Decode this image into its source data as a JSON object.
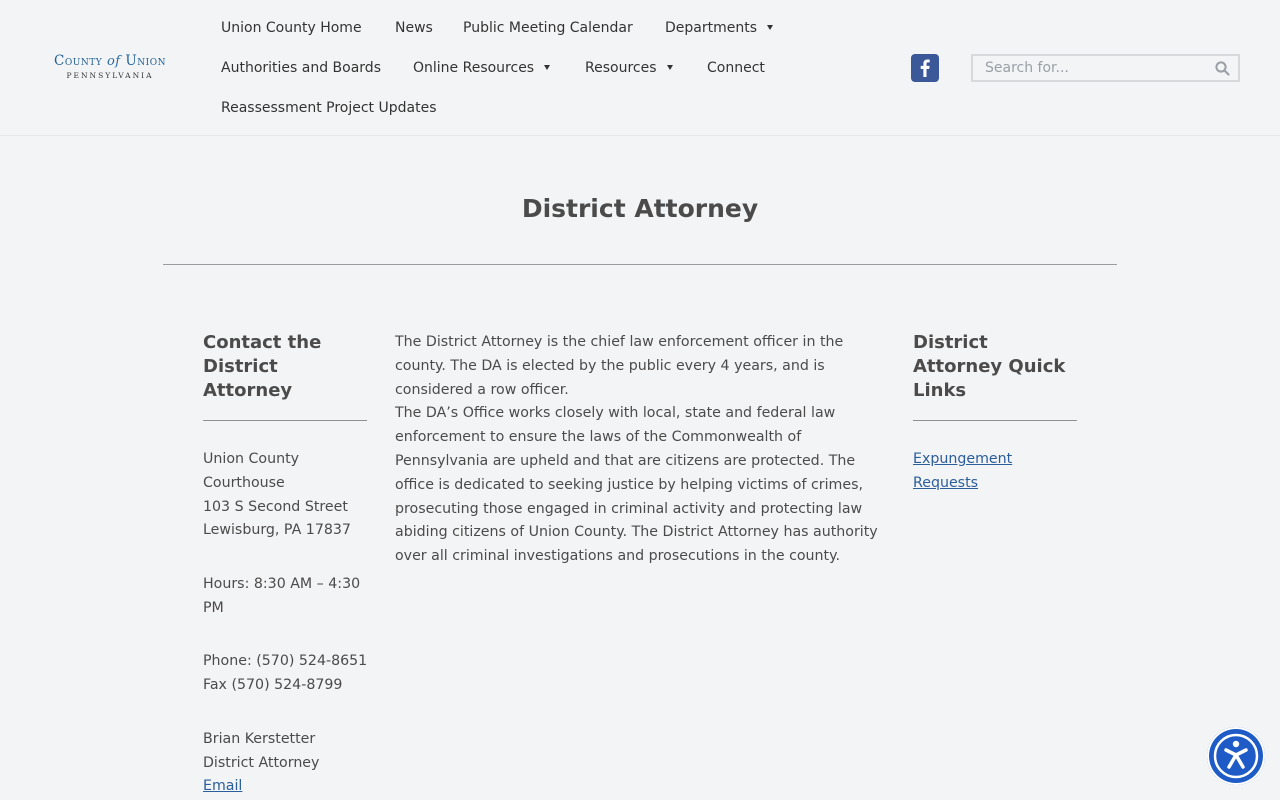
{
  "logo": {
    "line1_a": "County",
    "line1_of": "of",
    "line1_b": "Union",
    "line2": "PENNSYLVANIA"
  },
  "nav": {
    "items": [
      {
        "label": "Union County Home",
        "dropdown": false
      },
      {
        "label": "News",
        "dropdown": false
      },
      {
        "label": "Public Meeting Calendar",
        "dropdown": false
      },
      {
        "label": "Departments",
        "dropdown": true
      },
      {
        "label": "Authorities and Boards",
        "dropdown": false
      },
      {
        "label": "Online Resources",
        "dropdown": true
      },
      {
        "label": "Resources",
        "dropdown": true
      },
      {
        "label": "Connect",
        "dropdown": false
      },
      {
        "label": "Reassessment Project Updates",
        "dropdown": false
      }
    ]
  },
  "social": {
    "facebook_icon": "facebook-icon"
  },
  "search": {
    "placeholder": "Search for..."
  },
  "page": {
    "title": "District Attorney"
  },
  "contact": {
    "heading": "Contact the District Attorney",
    "address_1": "Union County Courthouse",
    "address_2": "103 S Second Street",
    "address_3": "Lewisburg, PA 17837",
    "hours": "Hours: 8:30 AM – 4:30 PM",
    "phone": "Phone: (570) 524-8651",
    "fax": "Fax (570) 524-8799",
    "person_name": "Brian Kerstetter",
    "person_title": "District Attorney",
    "email_link": "Email"
  },
  "main": {
    "para1": "The District Attorney is the chief law enforcement officer in the county. The DA is elected by the public every 4 years, and is considered a row officer.",
    "para2": "The DA’s Office works closely with local, state and federal law enforcement to ensure the laws of the Commonwealth of Pennsylvania are upheld and that are citizens are protected. The office is dedicated to seeking justice by helping victims of crimes, prosecuting those engaged in criminal activity and protecting law abiding citizens of Union County. The District Attorney has authority over all criminal investigations and prosecutions in the county."
  },
  "quick_links": {
    "heading": "District Attorney Quick Links",
    "links": [
      {
        "label": "Expungement Requests"
      }
    ]
  },
  "accessibility": {
    "icon": "accessibility-icon"
  },
  "colors": {
    "accent": "#2b5d9a",
    "facebook": "#3b5998",
    "accessibility": "#1e5bc6"
  }
}
